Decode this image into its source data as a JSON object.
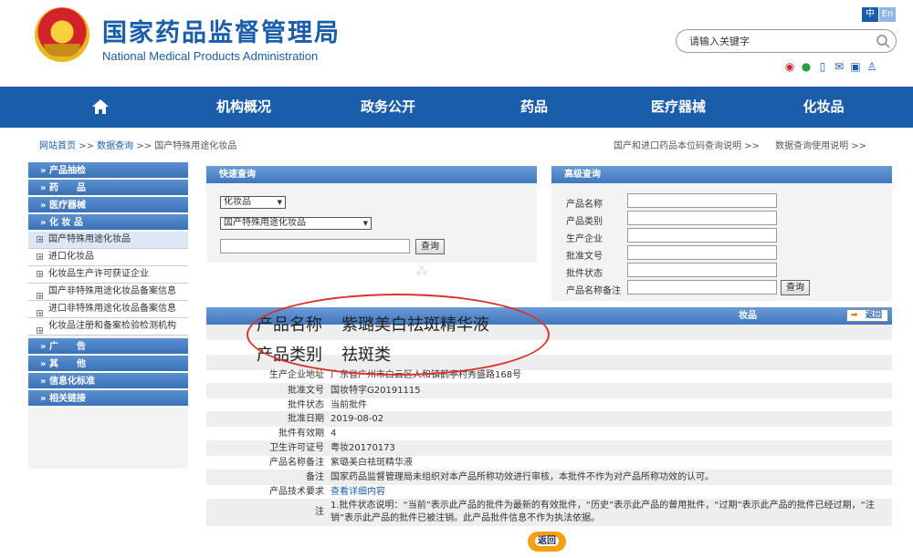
{
  "header": {
    "title_cn": "国家药品监督管理局",
    "title_en": "National Medical Products Administration",
    "lang_zh": "中",
    "lang_en": "En",
    "search_placeholder": "请输入关键字",
    "social_icons": [
      "weibo-icon",
      "wechat-icon",
      "mobile-icon",
      "mail-icon",
      "message-icon",
      "user-icon"
    ]
  },
  "nav": {
    "items": [
      "机构概况",
      "政务公开",
      "药品",
      "医疗器械",
      "化妆品"
    ]
  },
  "breadcrumb": {
    "home": "网站首页",
    "query": "数据查询",
    "current": "国产特殊用途化妆品",
    "sep": ">>",
    "right_links": [
      "国产和进口药品本位码查询说明 >>",
      "数据查询使用说明 >>"
    ]
  },
  "sidebar": {
    "heads": [
      "» 产品抽检",
      "» 药　　品",
      "» 医疗器械",
      "» 化 妆 品"
    ],
    "subs": [
      "国产特殊用途化妆品",
      "进口化妆品",
      "化妆品生产许可获证企业",
      "国产非特殊用途化妆品备案信息",
      "进口非特殊用途化妆品备案信息",
      "化妆品注册和备案检验检测机构"
    ],
    "heads_bottom": [
      "» 广　　告",
      "» 其　　他",
      "» 信息化标准",
      "» 相关链接"
    ]
  },
  "quick_search": {
    "title": "快速查询",
    "category": "化妆品",
    "subcategory": "国产特殊用途化妆品",
    "button": "查询"
  },
  "advanced_search": {
    "title": "高级查询",
    "labels": [
      "产品名称",
      "产品类别",
      "生产企业",
      "批准文号",
      "批件状态",
      "产品名称备注"
    ],
    "button": "查询"
  },
  "detail": {
    "header_suffix": "妆品",
    "back": "返回",
    "rows": [
      {
        "k": "生产企业地址",
        "v": "广东省广州市白云区人和镇鹤亭村秀盛路168号"
      },
      {
        "k": "批准文号",
        "v": "国妆特字G20191115"
      },
      {
        "k": "批件状态",
        "v": "当前批件"
      },
      {
        "k": "批准日期",
        "v": "2019-08-02"
      },
      {
        "k": "批件有效期",
        "v": "4"
      },
      {
        "k": "卫生许可证号",
        "v": "粤妆20170173"
      },
      {
        "k": "产品名称备注",
        "v": "紫璐美白祛斑精华液"
      },
      {
        "k": "备注",
        "v": "国家药品监督管理局未组织对本产品所称功效进行审核，本批件不作为对产品所称功效的认可。"
      },
      {
        "k": "产品技术要求",
        "v": "查看详细内容"
      }
    ],
    "note_key": "注",
    "note_text": "1.批件状态说明：“当前”表示此产品的批件为最新的有效批件，“历史”表示此产品的曾用批件，“过期”表示此产品的批件已经过期，“注销”表示此产品的批件已被注销。此产品批件信息不作为执法依据。",
    "zoom_name_label": "产品名称",
    "zoom_name_value": "紫璐美白祛斑精华液",
    "zoom_type_label": "产品类别",
    "zoom_type_value": "祛斑类",
    "return_button": "返回"
  }
}
